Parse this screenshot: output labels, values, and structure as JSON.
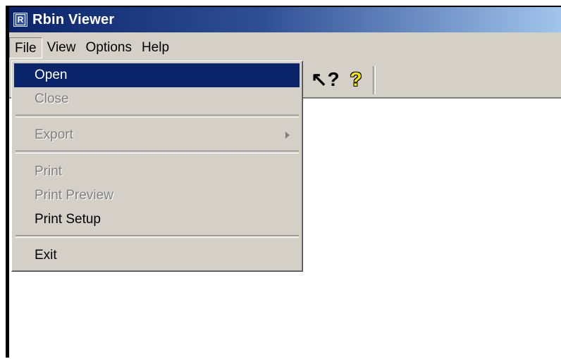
{
  "window": {
    "title": "Rbin Viewer",
    "icon_letter": "R"
  },
  "menubar": {
    "items": [
      "File",
      "View",
      "Options",
      "Help"
    ],
    "active": "File"
  },
  "toolbar": {
    "whats_this_glyph": "↖?",
    "help_glyph": "?",
    "icons": [
      "whats-this-icon",
      "help-icon"
    ]
  },
  "file_menu": {
    "items": [
      {
        "label": "Open",
        "state": "highlighted"
      },
      {
        "label": "Close",
        "state": "disabled"
      },
      {
        "label": "Export",
        "state": "disabled",
        "submenu": true
      },
      {
        "label": "Print",
        "state": "disabled"
      },
      {
        "label": "Print Preview",
        "state": "disabled"
      },
      {
        "label": "Print Setup",
        "state": "enabled"
      },
      {
        "label": "Exit",
        "state": "enabled"
      }
    ]
  },
  "colors": {
    "title_gradient_start": "#0a246a",
    "title_gradient_end": "#a6caf0",
    "menu_highlight": "#0a246a",
    "face": "#d4d0c8",
    "disabled_text": "#808080"
  }
}
